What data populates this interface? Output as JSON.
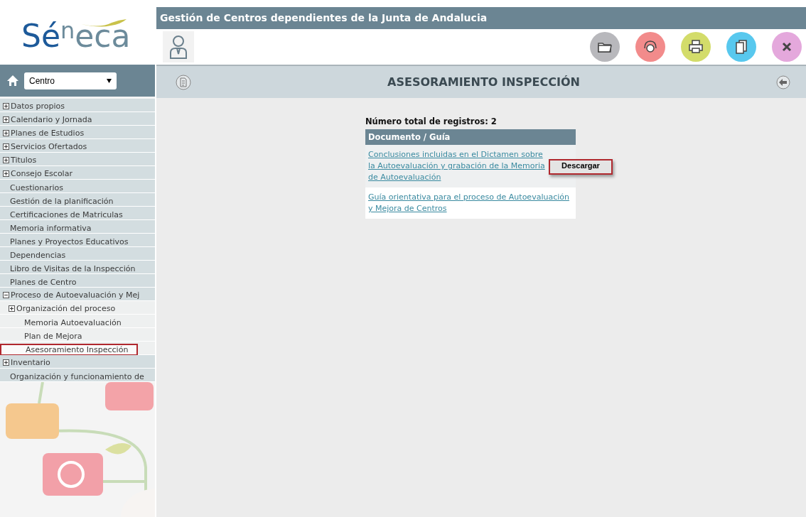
{
  "logo": {
    "first": "Sé",
    "raised": "n",
    "rest": "eca"
  },
  "header": {
    "title": "Gestión de Centros dependientes de la Junta de Andalucia"
  },
  "toolbar": [
    {
      "kind": "folder",
      "color": "#b8b8bc"
    },
    {
      "kind": "headset",
      "color": "#f28b8b"
    },
    {
      "kind": "printer",
      "color": "#d3dc6a"
    },
    {
      "kind": "copy",
      "color": "#58c8ee"
    },
    {
      "kind": "close",
      "color": "#e4a8dc"
    }
  ],
  "nav": {
    "select_value": "Centro"
  },
  "page_title": "ASESORAMIENTO INSPECCIÓN",
  "sidebar": {
    "items": [
      {
        "label": "Datos propios",
        "kind": "folder",
        "expanded": false,
        "selected": false
      },
      {
        "label": "Calendario y Jornada",
        "kind": "folder",
        "expanded": false,
        "selected": false
      },
      {
        "label": "Planes de Estudios",
        "kind": "folder",
        "expanded": false,
        "selected": false
      },
      {
        "label": "Servicios Ofertados",
        "kind": "folder",
        "expanded": false,
        "selected": false
      },
      {
        "label": "Titulos",
        "kind": "folder",
        "expanded": false,
        "selected": false
      },
      {
        "label": "Consejo Escolar",
        "kind": "folder",
        "expanded": false,
        "selected": false
      },
      {
        "label": "Cuestionarios",
        "kind": "leaf",
        "selected": false
      },
      {
        "label": "Gestión de la planificación",
        "kind": "leaf",
        "selected": false
      },
      {
        "label": "Certificaciones de Matriculas",
        "kind": "leaf",
        "selected": false
      },
      {
        "label": "Memoria informativa",
        "kind": "leaf",
        "selected": false
      },
      {
        "label": "Planes y Proyectos Educativos",
        "kind": "leaf",
        "selected": false
      },
      {
        "label": "Dependencias",
        "kind": "leaf",
        "selected": false
      },
      {
        "label": "Libro de Visitas de la Inspección",
        "kind": "leaf",
        "selected": false
      },
      {
        "label": "Planes de Centro",
        "kind": "leaf",
        "selected": false
      },
      {
        "label": "Proceso de Autoevaluación y Mej",
        "kind": "folder",
        "expanded": true,
        "selected": false,
        "children": [
          {
            "label": "Organización del proceso",
            "kind": "folder",
            "expanded": false,
            "selected": false
          },
          {
            "label": "Memoria Autoevaluación",
            "kind": "leaf",
            "selected": false
          },
          {
            "label": "Plan de Mejora",
            "kind": "leaf",
            "selected": false
          },
          {
            "label": "Asesoramiento Inspección",
            "kind": "leaf",
            "selected": true
          }
        ]
      },
      {
        "label": "Inventario",
        "kind": "folder",
        "expanded": false,
        "selected": false
      },
      {
        "label": "Organización y funcionamiento de",
        "kind": "leaf",
        "selected": false
      }
    ]
  },
  "records": {
    "total": "Número total de registros: 2",
    "column": "Documento / Guía",
    "rows": [
      {
        "text": "Conclusiones incluidas en el Dictamen sobre la Autoevaluación y grabación de la Memoria de Autoevaluación",
        "highlighted": true,
        "action": "Descargar"
      },
      {
        "text": "Guía orientativa para el proceso de Autoevaluación y Mejora de Centros",
        "highlighted": false
      }
    ]
  }
}
